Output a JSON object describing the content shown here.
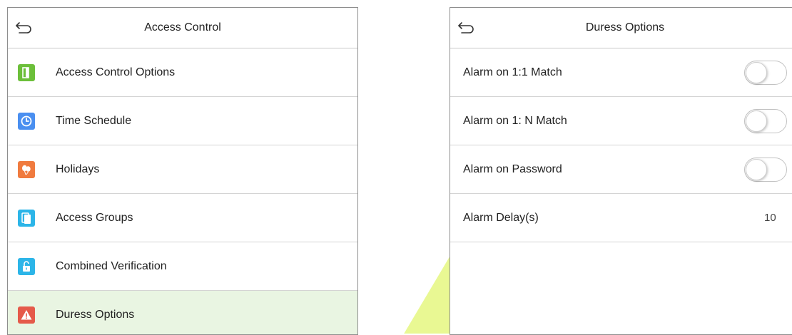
{
  "colors": {
    "selected_row": "#e9f5e2",
    "icon_green": "#6cbf3a",
    "icon_blue": "#4a8ff0",
    "icon_orange": "#f07b3f",
    "icon_teal": "#2cb5e8",
    "icon_red": "#e55a4a",
    "watermark": "#d7f23a"
  },
  "left_panel": {
    "title": "Access Control",
    "back_icon": "back-arrow-icon",
    "items": [
      {
        "label": "Access Control Options",
        "icon": "door-icon",
        "selected": false
      },
      {
        "label": "Time Schedule",
        "icon": "clock-icon",
        "selected": false
      },
      {
        "label": "Holidays",
        "icon": "balloons-icon",
        "selected": false
      },
      {
        "label": "Access Groups",
        "icon": "group-door-icon",
        "selected": false
      },
      {
        "label": "Combined Verification",
        "icon": "unlock-icon",
        "selected": false
      },
      {
        "label": "Duress Options",
        "icon": "warning-icon",
        "selected": true
      }
    ]
  },
  "right_panel": {
    "title": "Duress Options",
    "back_icon": "back-arrow-icon",
    "items": [
      {
        "label": "Alarm on 1:1 Match",
        "type": "toggle",
        "on": false
      },
      {
        "label": "Alarm on 1: N Match",
        "type": "toggle",
        "on": false
      },
      {
        "label": "Alarm on Password",
        "type": "toggle",
        "on": false
      },
      {
        "label": "Alarm Delay(s)",
        "type": "value",
        "value": "10"
      }
    ]
  }
}
